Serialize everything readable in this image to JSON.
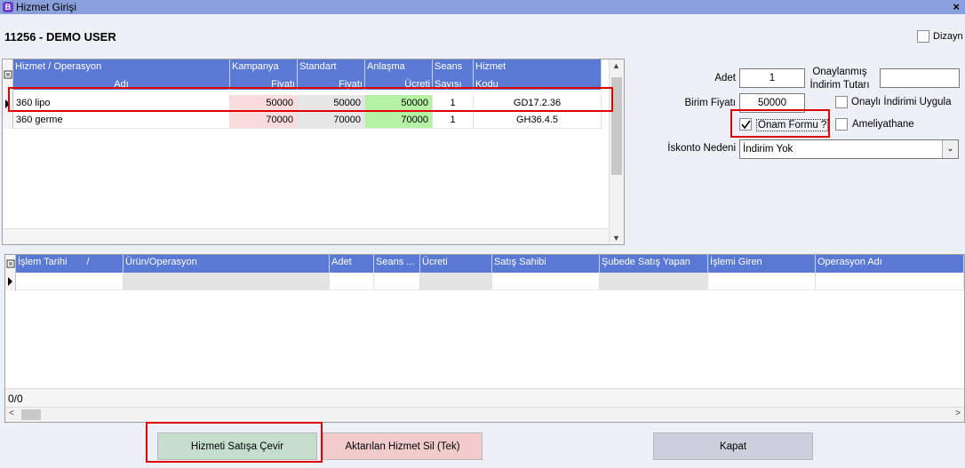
{
  "window": {
    "title": "Hizmet Girişi",
    "close_label": "×",
    "app_icon_letter": "B"
  },
  "user_line": "11256  -  DEMO USER",
  "dizayn_label": "Dizayn",
  "services_grid": {
    "headers": [
      {
        "top": "Hizmet / Operasyon",
        "bottom": "Adı"
      },
      {
        "top": "Kampanya",
        "bottom": "Fiyatı"
      },
      {
        "top": "Standart",
        "bottom": "Fiyatı"
      },
      {
        "top": "Anlaşma",
        "bottom": "Ücreti"
      },
      {
        "top": "Seans",
        "bottom": "Sayısı"
      },
      {
        "top": "Hizmet",
        "bottom": "Kodu"
      }
    ],
    "rows": [
      {
        "name": "360 lipo",
        "kampanya": "50000",
        "standart": "50000",
        "anlasma": "50000",
        "seans": "1",
        "kod": "GD17.2.36"
      },
      {
        "name": "360 germe",
        "kampanya": "70000",
        "standart": "70000",
        "anlasma": "70000",
        "seans": "1",
        "kod": "GH36.4.5"
      }
    ]
  },
  "form": {
    "adet_label": "Adet",
    "adet_value": "1",
    "onaylanmis_label_1": "Onaylanmış",
    "onaylanmis_label_2": "İndirim Tutarı",
    "onaylanmis_value": "",
    "birim_fiyati_label": "Birim Fiyatı",
    "birim_fiyati_value": "50000",
    "onayli_indirim_label": "Onaylı İndirimi Uygula",
    "onam_formu_label": "Onam Formu ?",
    "onam_formu_checked": true,
    "ameliyathane_label": "Ameliyathane",
    "iskonto_label": "İskonto Nedeni",
    "iskonto_value": "İndirim Yok"
  },
  "sales_grid": {
    "headers": [
      "İşlem Tarihi",
      "Ürün/Operasyon",
      "Adet",
      "Seans ...",
      "Ücreti",
      "Satış Sahibi",
      "Şubede Satış Yapan",
      "İşlemi Giren",
      "Operasyon Adı"
    ],
    "count": "0/0"
  },
  "buttons": {
    "convert": "Hizmeti Satışa Çevir",
    "delete": "Aktarılan Hizmet Sil (Tek)",
    "close": "Kapat"
  },
  "colors": {
    "header_blue": "#5a79d4",
    "kampanya_cell": "#fadcdc",
    "standart_cell": "#e6e6e6",
    "anlasma_cell": "#b6f2a6",
    "highlight_red": "#e00000",
    "convert_btn": "#c5dfcc",
    "delete_btn": "#f2cccc",
    "close_btn": "#cdd0dc"
  }
}
